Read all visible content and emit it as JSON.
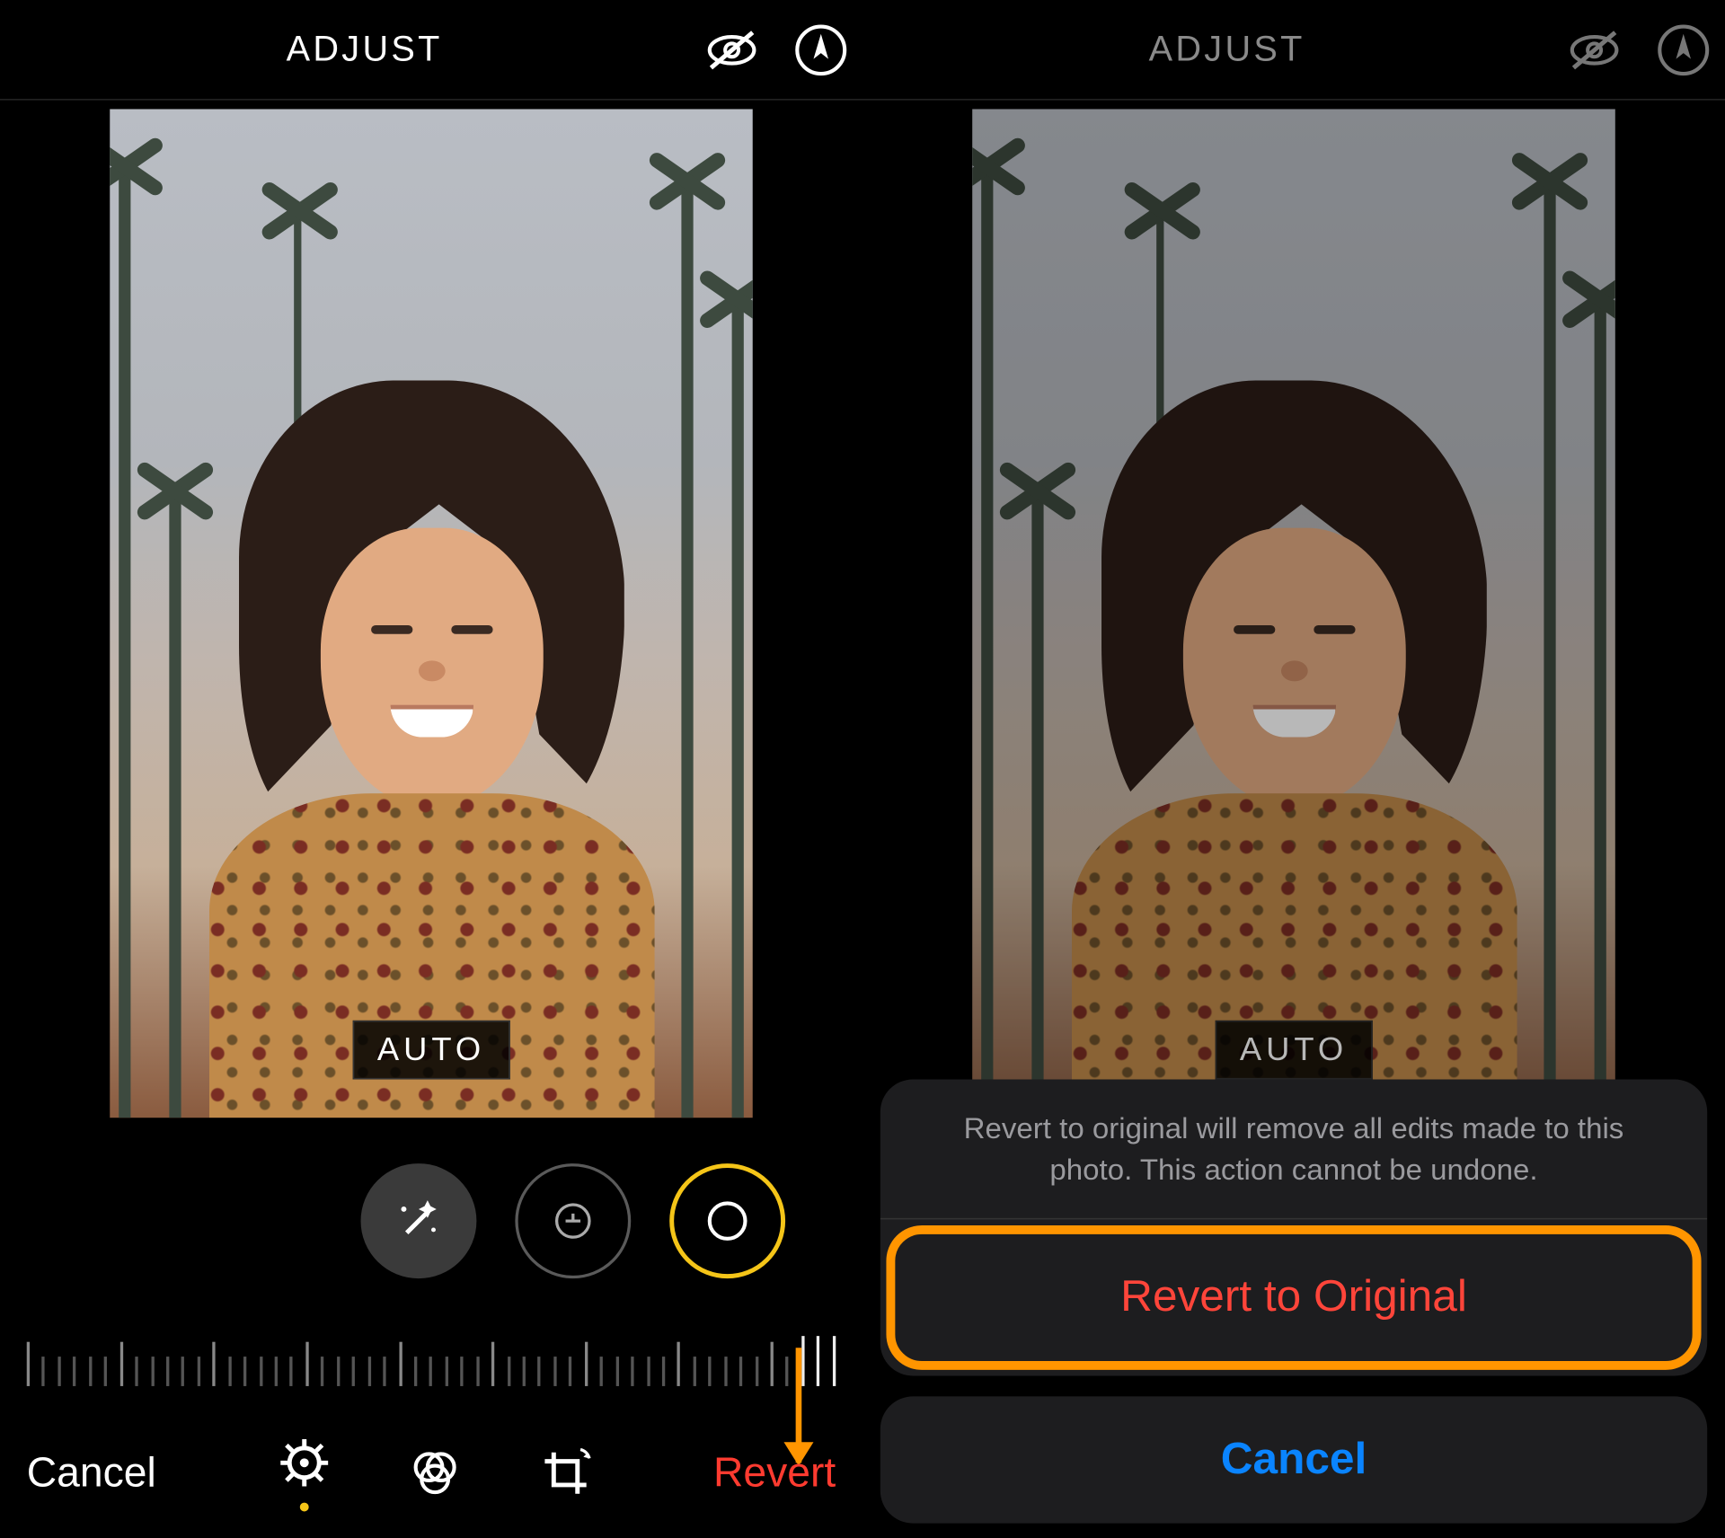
{
  "left": {
    "header": {
      "title": "ADJUST"
    },
    "badge": "AUTO",
    "bottom": {
      "cancel": "Cancel",
      "revert": "Revert"
    },
    "icons": {
      "hide": "eye-off-icon",
      "markup": "markup-icon",
      "wand": "magic-wand-icon",
      "exposure": "exposure-icon",
      "brilliance": "brilliance-icon",
      "adjust": "adjust-icon",
      "filters": "filters-icon",
      "crop": "crop-icon"
    }
  },
  "right": {
    "header": {
      "title": "ADJUST"
    },
    "badge": "AUTO",
    "sheet": {
      "message": "Revert to original will remove all edits made to this photo. This action cannot be undone.",
      "revert": "Revert to Original",
      "cancel": "Cancel"
    }
  },
  "colors": {
    "destructive": "#ff453a",
    "accent_yellow": "#f5c518",
    "link_blue": "#0a84ff",
    "annotation_orange": "#ff9500"
  }
}
